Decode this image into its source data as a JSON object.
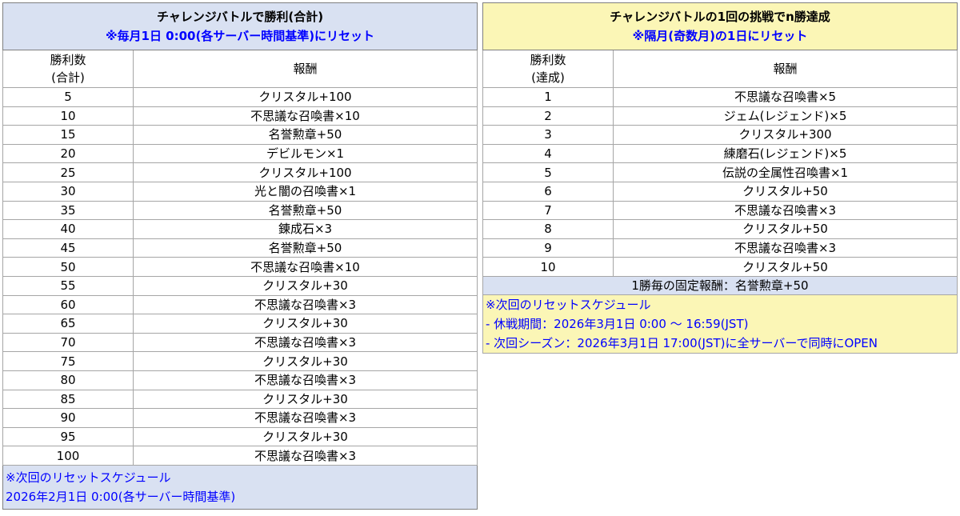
{
  "left": {
    "title": "チャレンジバトルで勝利(合計)",
    "subtitle": "※毎月1日 0:00(各サーバー時間基準)にリセット",
    "header_count_line1": "勝利数",
    "header_count_line2": "(合計)",
    "header_reward": "報酬",
    "rows": [
      {
        "count": "5",
        "reward": "クリスタル+100"
      },
      {
        "count": "10",
        "reward": "不思議な召喚書×10"
      },
      {
        "count": "15",
        "reward": "名誉勲章+50"
      },
      {
        "count": "20",
        "reward": "デビルモン×1"
      },
      {
        "count": "25",
        "reward": "クリスタル+100"
      },
      {
        "count": "30",
        "reward": "光と闇の召喚書×1"
      },
      {
        "count": "35",
        "reward": "名誉勲章+50"
      },
      {
        "count": "40",
        "reward": "錬成石×3"
      },
      {
        "count": "45",
        "reward": "名誉勲章+50"
      },
      {
        "count": "50",
        "reward": "不思議な召喚書×10"
      },
      {
        "count": "55",
        "reward": "クリスタル+30"
      },
      {
        "count": "60",
        "reward": "不思議な召喚書×3"
      },
      {
        "count": "65",
        "reward": "クリスタル+30"
      },
      {
        "count": "70",
        "reward": "不思議な召喚書×3"
      },
      {
        "count": "75",
        "reward": "クリスタル+30"
      },
      {
        "count": "80",
        "reward": "不思議な召喚書×3"
      },
      {
        "count": "85",
        "reward": "クリスタル+30"
      },
      {
        "count": "90",
        "reward": "不思議な召喚書×3"
      },
      {
        "count": "95",
        "reward": "クリスタル+30"
      },
      {
        "count": "100",
        "reward": "不思議な召喚書×3"
      }
    ],
    "notes": [
      "※次回のリセットスケジュール",
      "2026年2月1日 0:00(各サーバー時間基準)"
    ]
  },
  "right": {
    "title": "チャレンジバトルの1回の挑戦でn勝達成",
    "subtitle": "※隔月(奇数月)の1日にリセット",
    "header_count_line1": "勝利数",
    "header_count_line2": "(達成)",
    "header_reward": "報酬",
    "rows": [
      {
        "count": "1",
        "reward": "不思議な召喚書×5"
      },
      {
        "count": "2",
        "reward": "ジェム(レジェンド)×5"
      },
      {
        "count": "3",
        "reward": "クリスタル+300"
      },
      {
        "count": "4",
        "reward": "練磨石(レジェンド)×5"
      },
      {
        "count": "5",
        "reward": "伝説の全属性召喚書×1"
      },
      {
        "count": "6",
        "reward": "クリスタル+50"
      },
      {
        "count": "7",
        "reward": "不思議な召喚書×3"
      },
      {
        "count": "8",
        "reward": "クリスタル+50"
      },
      {
        "count": "9",
        "reward": "不思議な召喚書×3"
      },
      {
        "count": "10",
        "reward": "クリスタル+50"
      }
    ],
    "fixed_reward": "1勝毎の固定報酬：名誉勲章+50",
    "notes": [
      "※次回のリセットスケジュール",
      "- 休戦期間：2026年3月1日 0:00 ～ 16:59(JST)",
      "- 次回シーズン：2026年3月1日 17:00(JST)に全サーバーで同時にOPEN"
    ]
  }
}
